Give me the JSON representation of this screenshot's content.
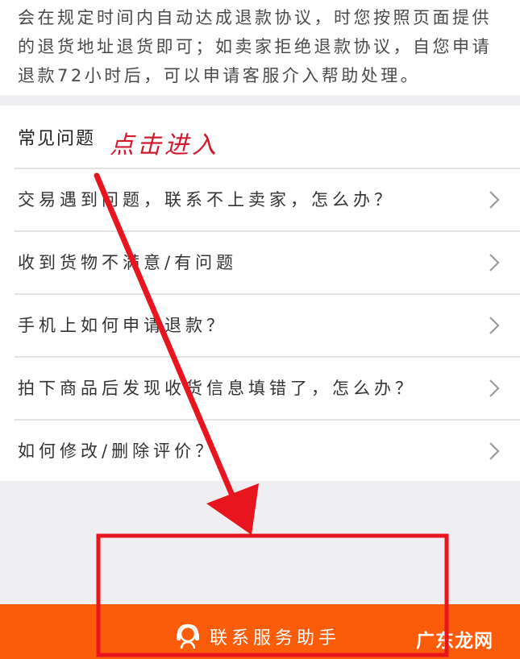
{
  "intro": {
    "lines": [
      "会在规定时间内自动达成退款协议，时您按照页面提供",
      "的退货地址退货即可；如卖家拒绝退款协议，自您申请",
      "退款72小时后，可以申请客服介入帮助处理。"
    ]
  },
  "faq": {
    "title": "常见问题",
    "annotation": "点击进入",
    "items": [
      {
        "label": "交易遇到问题，联系不上卖家，怎么办？"
      },
      {
        "label": "收到货物不满意/有问题"
      },
      {
        "label": "手机上如何申请退款？"
      },
      {
        "label": "拍下商品后发现收货信息填错了，怎么办？"
      },
      {
        "label": "如何修改/删除评价？"
      }
    ]
  },
  "footer": {
    "button_label": "联系服务助手",
    "icon": "customer-service-icon",
    "background": "#fb5c0a"
  },
  "watermark": "广东龙网",
  "colors": {
    "annotation": "#cf1b2c",
    "accent": "#fb5c0a"
  }
}
